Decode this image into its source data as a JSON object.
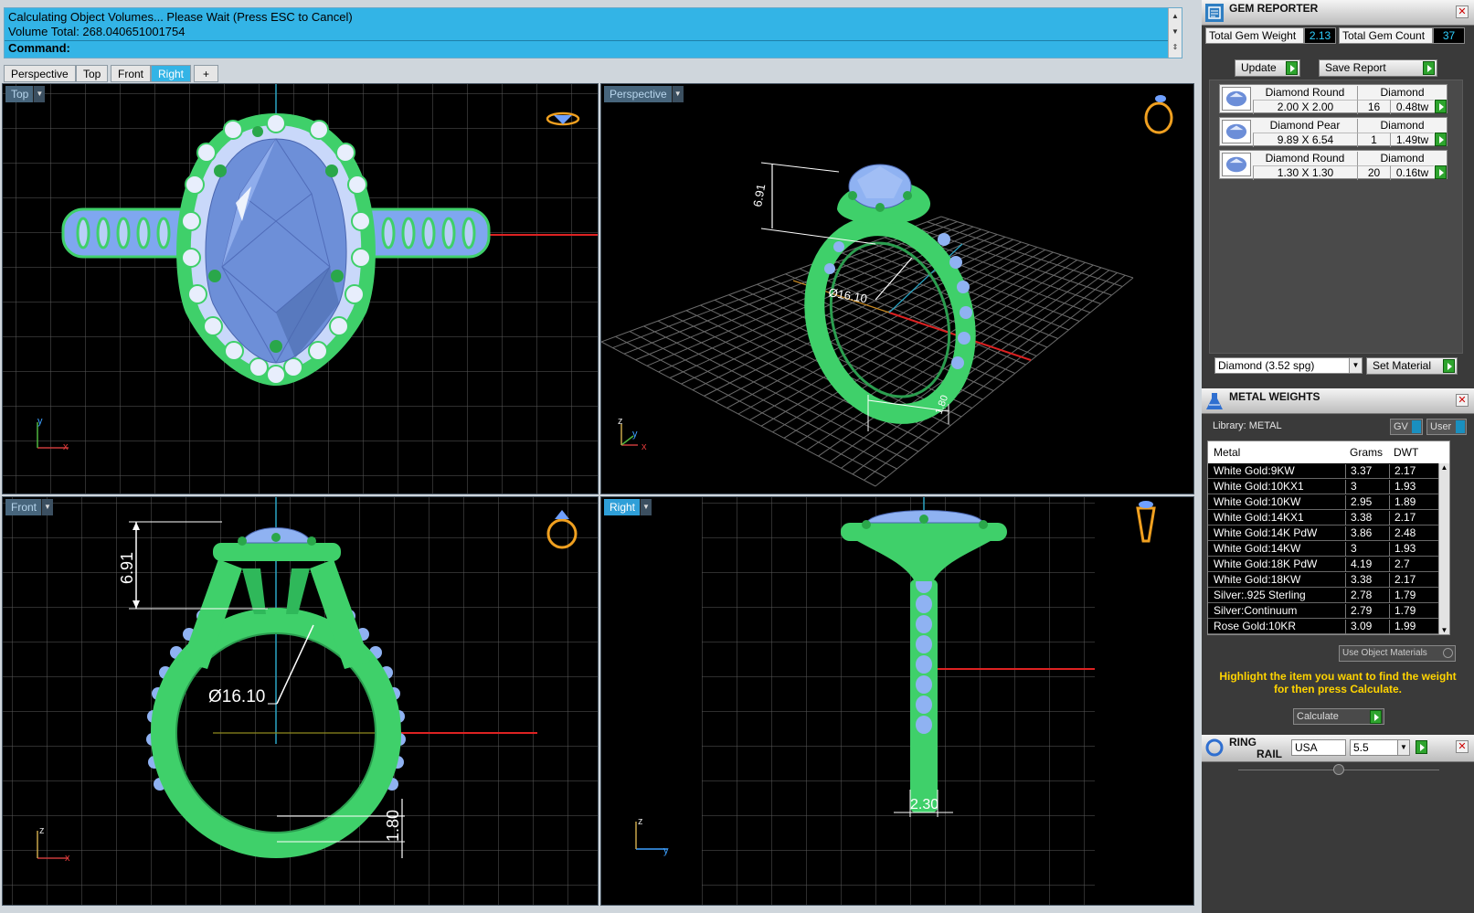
{
  "command": {
    "line1": "Calculating Object Volumes... Please Wait (Press ESC to Cancel)",
    "line2": "Volume Total: 268.040651001754",
    "prompt": "Command:"
  },
  "tabs": [
    "Perspective",
    "Top",
    "Front",
    "Right"
  ],
  "add_tab_icon": "+",
  "viewports": {
    "top": {
      "label": "Top"
    },
    "perspective": {
      "label": "Perspective"
    },
    "front": {
      "label": "Front"
    },
    "right": {
      "label": "Right"
    }
  },
  "annotations": {
    "height": "6.91",
    "diameter": "Ø16.10",
    "shank": "1.80",
    "width": "2.30"
  },
  "axes": {
    "x": "x",
    "y": "y",
    "z": "z"
  },
  "gem_reporter": {
    "title": "GEM REPORTER",
    "total_weight_label": "Total Gem Weight",
    "total_weight": "2.13",
    "total_count_label": "Total Gem Count",
    "total_count": "37",
    "update_label": "Update",
    "save_report_label": "Save Report",
    "gems": [
      {
        "name": "Diamond Round",
        "material": "Diamond",
        "size": "2.00 X 2.00",
        "count": "16",
        "weight": "0.48tw"
      },
      {
        "name": "Diamond Pear",
        "material": "Diamond",
        "size": "9.89 X 6.54",
        "count": "1",
        "weight": "1.49tw"
      },
      {
        "name": "Diamond Round",
        "material": "Diamond",
        "size": "1.30 X 1.30",
        "count": "20",
        "weight": "0.16tw"
      }
    ],
    "material_select": "Diamond     (3.52 spg)",
    "set_material_label": "Set Material"
  },
  "metal_weights": {
    "title": "METAL WEIGHTS",
    "library_label": "Library: METAL",
    "gv_label": "GV",
    "user_label": "User",
    "columns": [
      "Metal",
      "Grams",
      "DWT"
    ],
    "rows": [
      [
        "White Gold:9KW",
        "3.37",
        "2.17"
      ],
      [
        "White Gold:10KX1",
        "3",
        "1.93"
      ],
      [
        "White Gold:10KW",
        "2.95",
        "1.89"
      ],
      [
        "White Gold:14KX1",
        "3.38",
        "2.17"
      ],
      [
        "White Gold:14K PdW",
        "3.86",
        "2.48"
      ],
      [
        "White Gold:14KW",
        "3",
        "1.93"
      ],
      [
        "White Gold:18K PdW",
        "4.19",
        "2.7"
      ],
      [
        "White Gold:18KW",
        "3.38",
        "2.17"
      ],
      [
        "Silver:.925 Sterling",
        "2.78",
        "1.79"
      ],
      [
        "Silver:Continuum",
        "2.79",
        "1.79"
      ],
      [
        "Rose Gold:10KR",
        "3.09",
        "1.99"
      ]
    ],
    "use_object_materials_label": "Use Object Materials",
    "hint": "Highlight the item you want to find the weight for then press Calculate.",
    "calculate_label": "Calculate"
  },
  "ring_rail": {
    "title_1": "RING",
    "title_2": "RAIL",
    "country": "USA",
    "size": "5.5"
  },
  "colors": {
    "command_bg": "#33b4e6",
    "metal_green": "#3fd06a",
    "gem_blue": "#8fb2f2",
    "hint_yellow": "#ffd400",
    "readout_cyan": "#2fd0ff"
  }
}
